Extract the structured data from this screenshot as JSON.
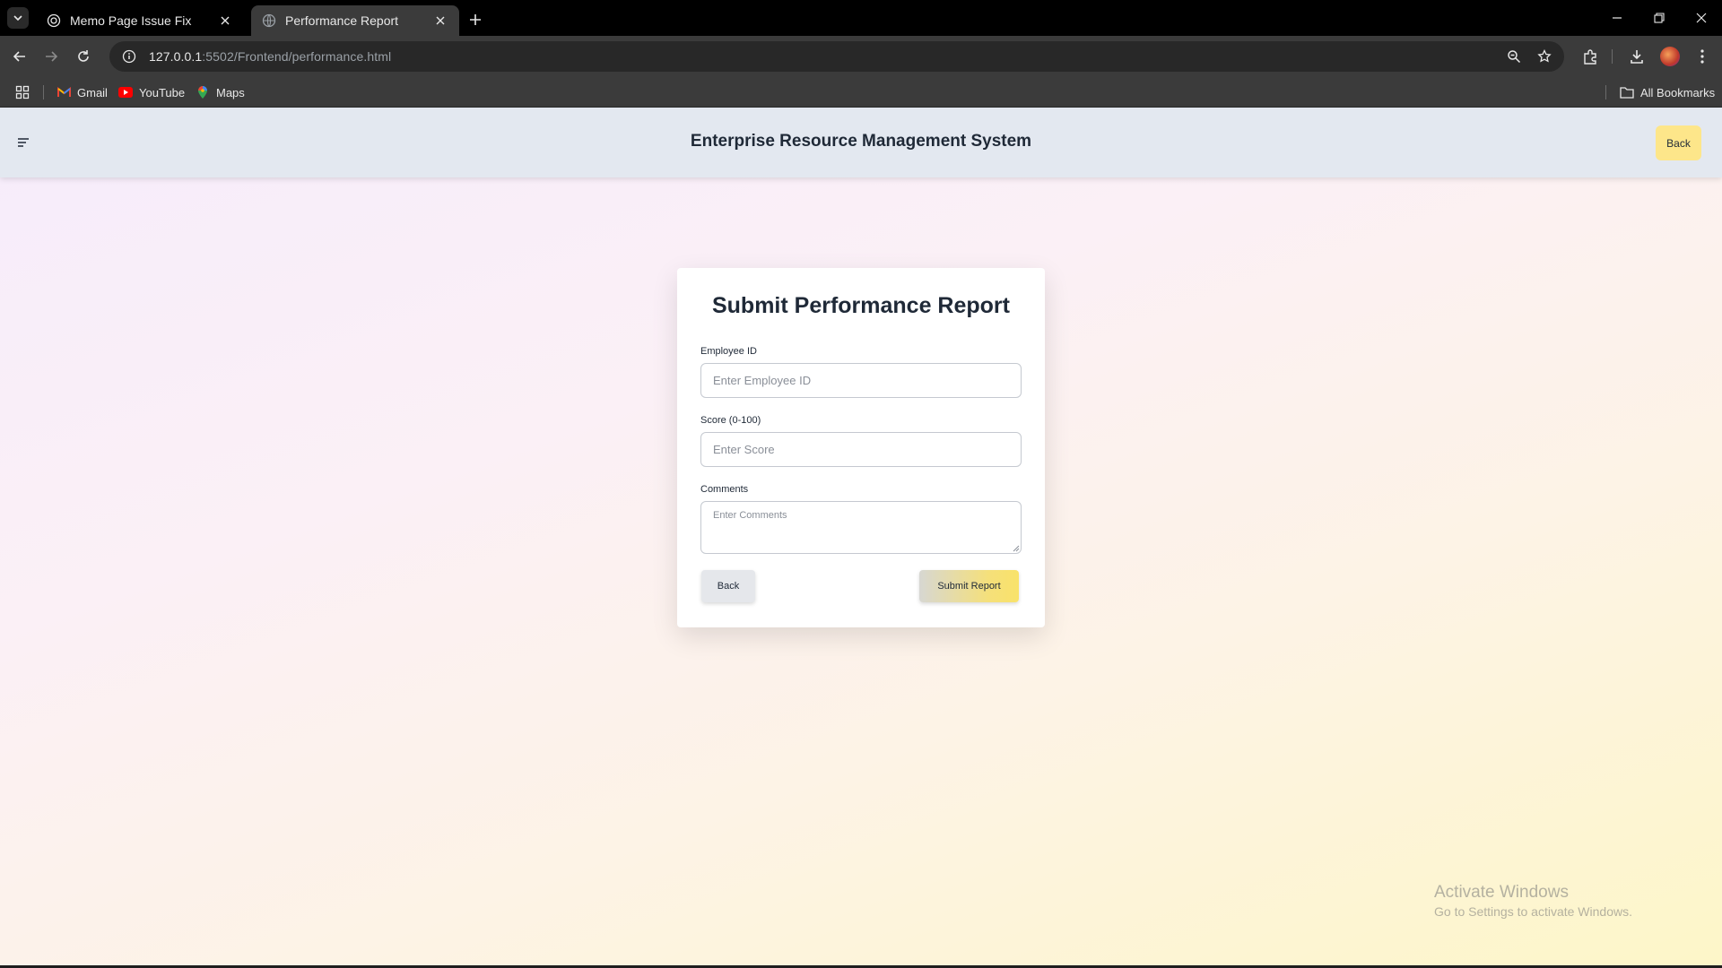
{
  "browser": {
    "tabs": [
      {
        "title": "Memo Page Issue Fix",
        "active": false
      },
      {
        "title": "Performance Report",
        "active": true
      }
    ],
    "url": {
      "host": "127.0.0.1",
      "rest": ":5502/Frontend/performance.html"
    },
    "bookmarks": [
      {
        "label": "Gmail",
        "icon": "gmail-icon"
      },
      {
        "label": "YouTube",
        "icon": "youtube-icon"
      },
      {
        "label": "Maps",
        "icon": "maps-icon"
      }
    ],
    "all_bookmarks_label": "All Bookmarks"
  },
  "header": {
    "title": "Enterprise Resource Management System",
    "back_label": "Back",
    "menu_icon": "menu-icon"
  },
  "form": {
    "title": "Submit Performance Report",
    "employee_id": {
      "label": "Employee ID",
      "placeholder": "Enter Employee ID",
      "value": ""
    },
    "score": {
      "label": "Score (0-100)",
      "placeholder": "Enter Score",
      "value": ""
    },
    "comments": {
      "label": "Comments",
      "placeholder": "Enter Comments",
      "value": ""
    },
    "back_label": "Back",
    "submit_label": "Submit Report"
  },
  "watermark": {
    "title": "Activate Windows",
    "subtitle": "Go to Settings to activate Windows."
  },
  "colors": {
    "header_bg": "#e3e8f0",
    "back_button": "#fde68a",
    "submit_accent": "#f9e26a"
  }
}
